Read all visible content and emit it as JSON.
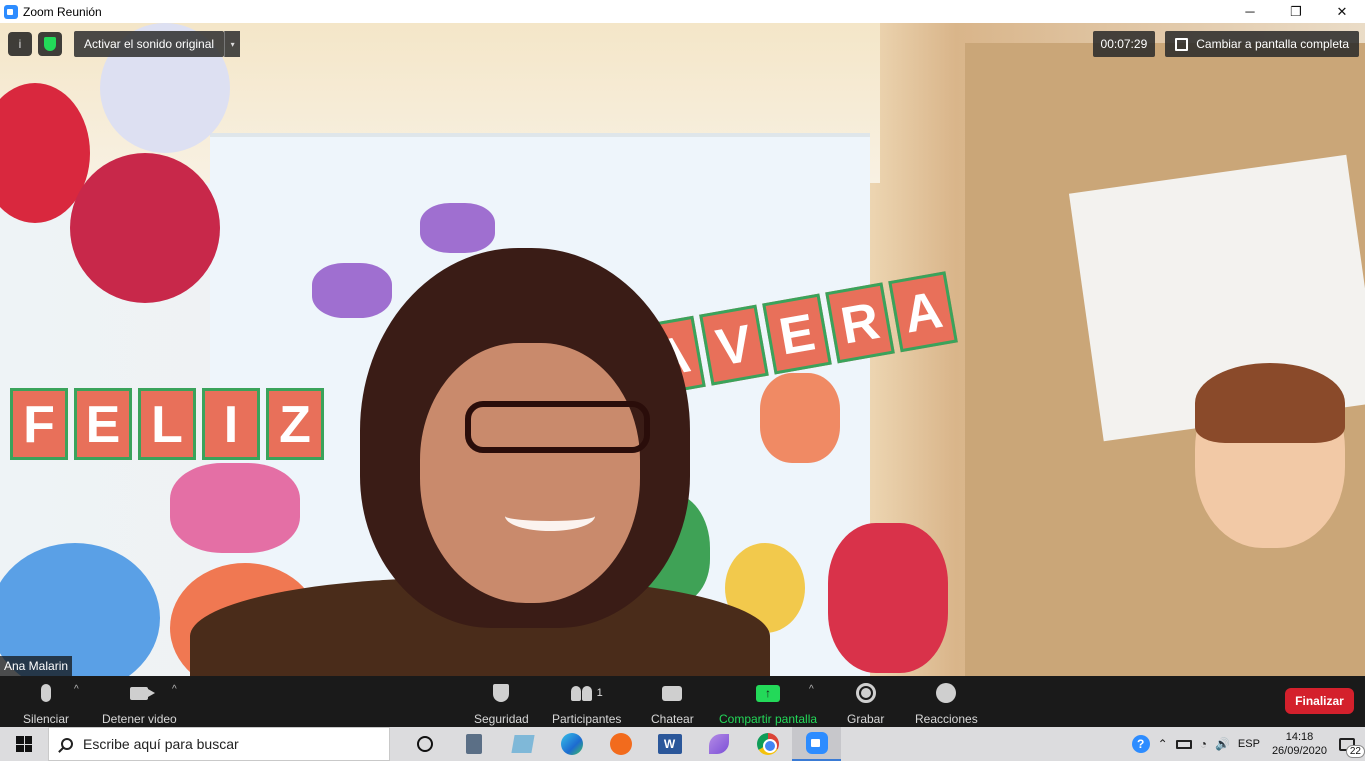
{
  "window": {
    "title": "Zoom Reunión",
    "minimize": "─",
    "maximize": "❐",
    "close": "✕"
  },
  "meeting_controls": {
    "info_icon": "i",
    "sound_button_label": "Activar el sonido original",
    "sound_arrow": "▾",
    "elapsed_time": "00:07:29",
    "fullscreen_label": "Cambiar a pantalla completa"
  },
  "video": {
    "participant_name": "Ana Malarin",
    "banner_left": [
      "F",
      "E",
      "L",
      "I",
      "Z"
    ],
    "banner_right": [
      "A",
      "V",
      "E",
      "R",
      "A"
    ]
  },
  "toolbar": {
    "mute_label": "Silenciar",
    "video_label": "Detener video",
    "security_label": "Seguridad",
    "participants_label": "Participantes",
    "participants_count": "1",
    "chat_label": "Chatear",
    "share_label": "Compartir pantalla",
    "share_arrow": "↑",
    "record_label": "Grabar",
    "reactions_label": "Reacciones",
    "end_label": "Finalizar",
    "caret": "^"
  },
  "taskbar": {
    "search_placeholder": "Escribe aquí para buscar",
    "word_letter": "W",
    "help": "?",
    "tray_up": "⌃",
    "wifi": "◔",
    "volume": "🔊",
    "language": "ESP",
    "time": "14:18",
    "date": "26/09/2020",
    "notification_count": "22"
  },
  "colors": {
    "share_green": "#23d959",
    "end_red": "#d4202c",
    "zoom_blue": "#2d8cff",
    "toolbar_bg": "#1a1a1a"
  }
}
